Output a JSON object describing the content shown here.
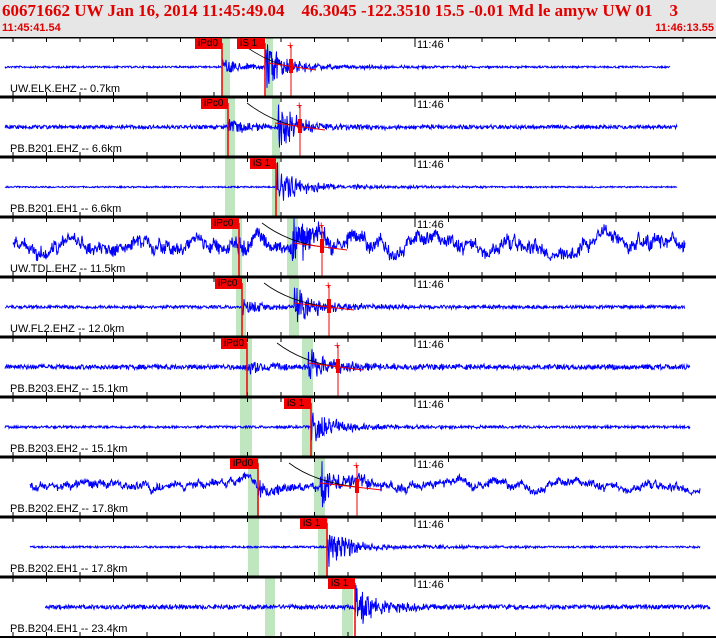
{
  "header": {
    "title": "60671662 UW Jan 16, 2014 11:45:49.04    46.3045 -122.3510 15.5 -0.01 Md le amyw UW 01    3",
    "start_time": "11:45:41.54",
    "end_time": "11:46:13.55"
  },
  "minute_label": "11:46",
  "colors": {
    "trace": "#0000ff",
    "pick": "#f00000",
    "window": "#bfe6bf",
    "header_bg": "#e6e6e6"
  },
  "traces": [
    {
      "label": "UW.ELK.EHZ -- 0.7km",
      "picks": [
        "iPd0",
        "iS 1"
      ]
    },
    {
      "label": "PB.B201.EHZ -- 6.6km",
      "picks": [
        "iPc0"
      ]
    },
    {
      "label": "PB.B201.EH1 -- 6.6km",
      "picks": [
        "iS 1"
      ]
    },
    {
      "label": "UW.TDL.EHZ -- 11.5km",
      "picks": [
        "iPc0"
      ]
    },
    {
      "label": "UW.FL2.EHZ -- 12.0km",
      "picks": [
        "iPc0"
      ]
    },
    {
      "label": "PB.B203.EHZ -- 15.1km",
      "picks": [
        "iPd0"
      ]
    },
    {
      "label": "PB.B203.EH2 -- 15.1km",
      "picks": [
        "iS 1"
      ]
    },
    {
      "label": "PB.B202.EHZ -- 17.8km",
      "picks": [
        "iPd0"
      ]
    },
    {
      "label": "PB.B202.EH1 -- 17.8km",
      "picks": [
        "iS 1"
      ]
    },
    {
      "label": "PB.B204.EH1 -- 23.4km",
      "picks": [
        "iS 1"
      ]
    }
  ]
}
